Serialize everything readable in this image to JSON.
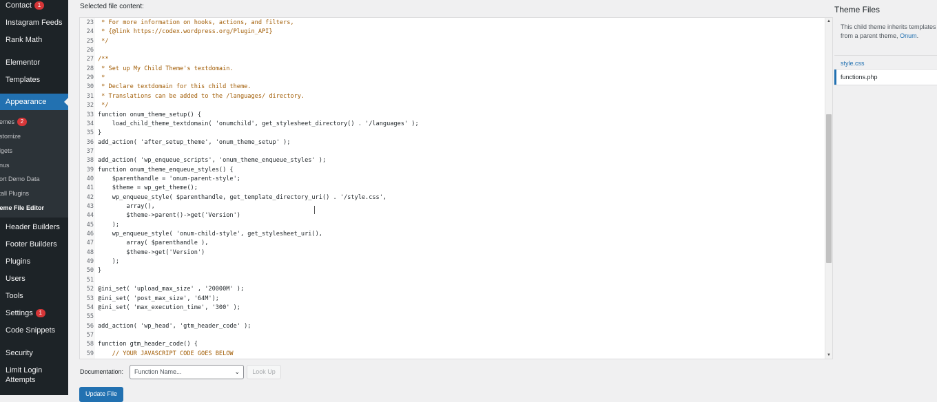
{
  "sidebar": {
    "items": [
      {
        "label": "Contact",
        "badge": "1"
      },
      {
        "label": "Instagram Feeds"
      },
      {
        "label": "Rank Math"
      },
      {
        "label": "Elementor"
      },
      {
        "label": "Templates"
      },
      {
        "label": "Appearance",
        "active": true
      },
      {
        "label": "Header Builders"
      },
      {
        "label": "Footer Builders"
      },
      {
        "label": "Plugins"
      },
      {
        "label": "Users"
      },
      {
        "label": "Tools"
      },
      {
        "label": "Settings",
        "badge": "1"
      },
      {
        "label": "Code Snippets"
      },
      {
        "label": "Security"
      },
      {
        "label": "Limit Login"
      },
      {
        "label": "Attempts"
      }
    ],
    "submenu": [
      {
        "label": "hemes",
        "badge": "2"
      },
      {
        "label": "ustomize"
      },
      {
        "label": "idgets"
      },
      {
        "label": "enus"
      },
      {
        "label": "port Demo Data"
      },
      {
        "label": "stall Plugins"
      },
      {
        "label": "heme File Editor",
        "current": true
      }
    ]
  },
  "editor": {
    "selected_label": "Selected file content:",
    "lines": [
      {
        "n": "23",
        "text": " * For more information on hooks, actions, and filters,",
        "comment": true
      },
      {
        "n": "24",
        "text": " * {@link https://codex.wordpress.org/Plugin_API}",
        "comment": true
      },
      {
        "n": "25",
        "text": " */",
        "comment": true
      },
      {
        "n": "26",
        "text": ""
      },
      {
        "n": "27",
        "text": "/**",
        "comment": true
      },
      {
        "n": "28",
        "text": " * Set up My Child Theme's textdomain.",
        "comment": true
      },
      {
        "n": "29",
        "text": " *",
        "comment": true
      },
      {
        "n": "30",
        "text": " * Declare textdomain for this child theme.",
        "comment": true
      },
      {
        "n": "31",
        "text": " * Translations can be added to the /languages/ directory.",
        "comment": true
      },
      {
        "n": "32",
        "text": " */",
        "comment": true
      },
      {
        "n": "33",
        "text": "function onum_theme_setup() {"
      },
      {
        "n": "34",
        "text": "    load_child_theme_textdomain( 'onumchild', get_stylesheet_directory() . '/languages' );"
      },
      {
        "n": "35",
        "text": "}"
      },
      {
        "n": "36",
        "text": "add_action( 'after_setup_theme', 'onum_theme_setup' );"
      },
      {
        "n": "37",
        "text": ""
      },
      {
        "n": "38",
        "text": "add_action( 'wp_enqueue_scripts', 'onum_theme_enqueue_styles' );"
      },
      {
        "n": "39",
        "text": "function onum_theme_enqueue_styles() {"
      },
      {
        "n": "40",
        "text": "    $parenthandle = 'onum-parent-style';"
      },
      {
        "n": "41",
        "text": "    $theme = wp_get_theme();"
      },
      {
        "n": "42",
        "text": "    wp_enqueue_style( $parenthandle, get_template_directory_uri() . '/style.css',"
      },
      {
        "n": "43",
        "text": "        array(),"
      },
      {
        "n": "44",
        "text": "        $theme->parent()->get('Version')"
      },
      {
        "n": "45",
        "text": "    );"
      },
      {
        "n": "46",
        "text": "    wp_enqueue_style( 'onum-child-style', get_stylesheet_uri(),"
      },
      {
        "n": "47",
        "text": "        array( $parenthandle ),"
      },
      {
        "n": "48",
        "text": "        $theme->get('Version')"
      },
      {
        "n": "49",
        "text": "    );"
      },
      {
        "n": "50",
        "text": "}"
      },
      {
        "n": "51",
        "text": ""
      },
      {
        "n": "52",
        "text": "@ini_set( 'upload_max_size' , '20000M' );"
      },
      {
        "n": "53",
        "text": "@ini_set( 'post_max_size', '64M');"
      },
      {
        "n": "54",
        "text": "@ini_set( 'max_execution_time', '300' );"
      },
      {
        "n": "55",
        "text": ""
      },
      {
        "n": "56",
        "text": "add_action( 'wp_head', 'gtm_header_code' );"
      },
      {
        "n": "57",
        "text": ""
      },
      {
        "n": "58",
        "text": "function gtm_header_code() {"
      },
      {
        "n": "59",
        "text": "    // YOUR JAVASCRIPT CODE GOES BELOW",
        "comment": true
      }
    ]
  },
  "theme_files": {
    "title": "Theme Files",
    "desc_prefix": "This child theme inherits templates from a parent theme,",
    "parent_link": "Onum",
    "desc_suffix": ".",
    "files": [
      {
        "label": "style.css"
      },
      {
        "label": "functions.php",
        "selected": true
      }
    ]
  },
  "bottom": {
    "doc_label": "Documentation:",
    "doc_placeholder": "Function Name...",
    "lookup_label": "Look Up",
    "update_label": "Update File"
  }
}
